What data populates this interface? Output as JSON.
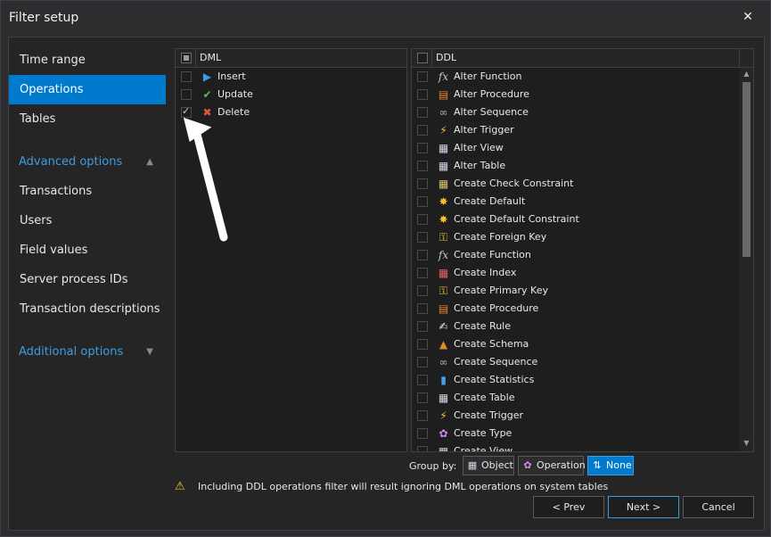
{
  "window": {
    "title": "Filter setup",
    "close_glyph": "✕"
  },
  "sidebar": {
    "items": [
      {
        "label": "Time range",
        "active": false
      },
      {
        "label": "Operations",
        "active": true
      },
      {
        "label": "Tables",
        "active": false
      }
    ],
    "advanced": {
      "label": "Advanced options",
      "expanded": true,
      "items": [
        {
          "label": "Transactions"
        },
        {
          "label": "Users"
        },
        {
          "label": "Field values"
        },
        {
          "label": "Server process IDs"
        },
        {
          "label": "Transaction descriptions"
        }
      ]
    },
    "additional": {
      "label": "Additional options",
      "expanded": false
    }
  },
  "dml": {
    "header": "DML",
    "header_state": "partial",
    "rows": [
      {
        "label": "Insert",
        "checked": false,
        "icon": "insert-icon"
      },
      {
        "label": "Update",
        "checked": false,
        "icon": "update-icon"
      },
      {
        "label": "Delete",
        "checked": true,
        "icon": "delete-icon"
      }
    ]
  },
  "ddl": {
    "header": "DDL",
    "header_state": "unchecked",
    "rows": [
      {
        "label": "Alter Function",
        "icon": "function-icon"
      },
      {
        "label": "Alter Procedure",
        "icon": "procedure-icon"
      },
      {
        "label": "Alter Sequence",
        "icon": "sequence-icon"
      },
      {
        "label": "Alter Trigger",
        "icon": "trigger-icon"
      },
      {
        "label": "Alter View",
        "icon": "view-icon"
      },
      {
        "label": "Alter Table",
        "icon": "table-icon"
      },
      {
        "label": "Create Check Constraint",
        "icon": "check-constraint-icon"
      },
      {
        "label": "Create Default",
        "icon": "default-icon"
      },
      {
        "label": "Create Default Constraint",
        "icon": "default-constraint-icon"
      },
      {
        "label": "Create Foreign Key",
        "icon": "foreign-key-icon"
      },
      {
        "label": "Create Function",
        "icon": "function-icon"
      },
      {
        "label": "Create Index",
        "icon": "index-icon"
      },
      {
        "label": "Create Primary Key",
        "icon": "primary-key-icon"
      },
      {
        "label": "Create Procedure",
        "icon": "procedure-icon"
      },
      {
        "label": "Create Rule",
        "icon": "rule-icon"
      },
      {
        "label": "Create Schema",
        "icon": "schema-icon"
      },
      {
        "label": "Create Sequence",
        "icon": "sequence-icon"
      },
      {
        "label": "Create Statistics",
        "icon": "statistics-icon"
      },
      {
        "label": "Create Table",
        "icon": "table-icon"
      },
      {
        "label": "Create Trigger",
        "icon": "trigger-icon"
      },
      {
        "label": "Create Type",
        "icon": "type-icon"
      },
      {
        "label": "Create View",
        "icon": "view-icon"
      }
    ]
  },
  "group_by": {
    "label": "Group by:",
    "options": [
      {
        "label": "Object",
        "icon": "object-icon",
        "active": false
      },
      {
        "label": "Operation",
        "icon": "operation-icon",
        "active": false
      },
      {
        "label": "None",
        "icon": "none-icon",
        "active": true
      }
    ]
  },
  "warning": {
    "icon": "warning-icon",
    "text": "Including DDL operations filter will result ignoring DML operations on system tables"
  },
  "buttons": {
    "prev": "< Prev",
    "next": "Next >",
    "cancel": "Cancel"
  },
  "colors": {
    "accent": "#007acc",
    "link": "#3d9ce0",
    "background": "#2d2d30",
    "panel": "#1e1e1e"
  }
}
